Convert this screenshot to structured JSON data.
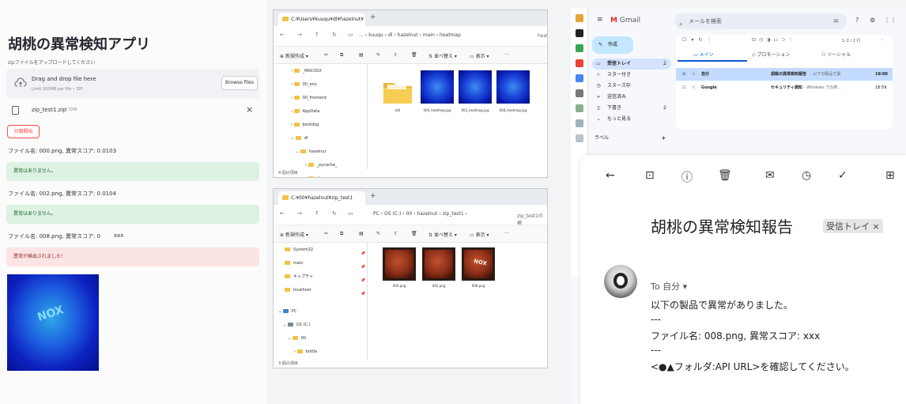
{
  "streamlit": {
    "title": "胡桃の異常検知アプリ",
    "upload_prompt": "zipファイルをアップロードしてください",
    "dropzone_main": "Drag and drop file here",
    "dropzone_limit": "Limit 200MB per file • ZIP",
    "browse_label": "Browse files",
    "file_name": "zip_test1.zip",
    "file_size": "3.5MB",
    "file_remove": "×",
    "run_button": "分類開始",
    "results": [
      {
        "line": "ファイル名: 000.png, 異常スコア: 0.0103",
        "status": "ok",
        "message": "異常はありません。"
      },
      {
        "line": "ファイル名: 002.png, 異常スコア: 0.0104",
        "status": "ok",
        "message": "異常はありません。"
      },
      {
        "line": "ファイル名: 008.png, 異常スコア: 0",
        "extra": "xxx",
        "status": "ng",
        "message": "異常が検出されました！"
      }
    ],
    "heatmap_label": "NOX"
  },
  "explorer1": {
    "tab_title": "C:¥Users¥kuuqu¥dl¥hazelnut¥",
    "breadcrumb": [
      "…",
      "kuuqu",
      "dl",
      "hazelnut",
      "main",
      "heatmap"
    ],
    "tail": "heat",
    "cmd": {
      "new": "新規作成",
      "sort": "並べ替え",
      "view": "表示"
    },
    "tree": [
      "_MACOSX",
      "00_env",
      "00_frontend",
      "AppData",
      "bootdog",
      "dl",
      "hazelnut",
      "_pycache_",
      "ds"
    ],
    "items": [
      "ddl",
      "000_heatmap.jpg",
      "002_heatmap.jpg",
      "008_heatmap.jpg"
    ],
    "status": "4 個の項目"
  },
  "explorer2": {
    "tab_title": "C:¥00¥hazelnut¥zip_test1",
    "breadcrumb": [
      "PC",
      "OS (C:)",
      "00",
      "hazelnut",
      "zip_test1"
    ],
    "tail": "zip_test1の検",
    "cmd": {
      "new": "新規作成",
      "sort": "並べ替え",
      "view": "表示"
    },
    "tree_pinned": [
      "System32",
      "main",
      "キャプチャ",
      "localhost"
    ],
    "tree": [
      "PC",
      "OS (C:)",
      "00",
      "bottle"
    ],
    "items": [
      "000.png",
      "002.png",
      "008.png"
    ],
    "nut_text": "NOX",
    "status": "3 個の項目"
  },
  "gmail": {
    "brand": "Gmail",
    "search_placeholder": "メールを検索",
    "compose": "作成",
    "nav": [
      {
        "label": "受信トレイ",
        "count": "2"
      },
      {
        "label": "スター付き",
        "count": ""
      },
      {
        "label": "スヌーズ中",
        "count": ""
      },
      {
        "label": "送信済み",
        "count": ""
      },
      {
        "label": "下書き",
        "count": "2"
      },
      {
        "label": "もっと見る",
        "count": ""
      }
    ],
    "labels_heading": "ラベル",
    "labels_add": "+",
    "pagination": "1–2 / 2 行",
    "tabs": [
      "メイン",
      "プロモーション",
      "ソーシャル"
    ],
    "rows": [
      {
        "sender": "自分",
        "subject": "胡桃の異常検知報告",
        "snippet": " - 以下の製品で異",
        "time": "19:00"
      },
      {
        "sender": "Google",
        "subject": "セキュリティ通知",
        "snippet": " - Windows での新…",
        "time": "18:59"
      }
    ],
    "mail": {
      "subject": "胡桃の異常検知報告",
      "label_chip": "受信トレイ ×",
      "to": "To 自分 ▾",
      "body": [
        "以下の製品で異常がありました。",
        "---",
        "ファイル名: 008.png, 異常スコア:     xxx",
        "---",
        "<●▲フォルダ:API URL>を確認してください。"
      ]
    }
  }
}
